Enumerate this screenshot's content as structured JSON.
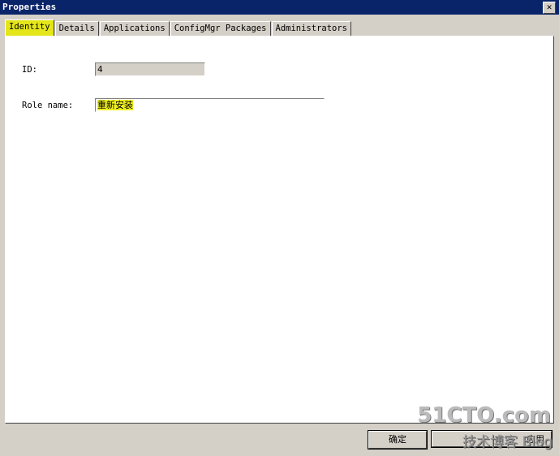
{
  "window": {
    "title": "Properties",
    "close": "✕"
  },
  "tabs": [
    {
      "label": "Identity"
    },
    {
      "label": "Details"
    },
    {
      "label": "Applications"
    },
    {
      "label": "ConfigMgr Packages"
    },
    {
      "label": "Administrators"
    }
  ],
  "form": {
    "id_label": "ID:",
    "id_value": "4",
    "role_label": "Role name:",
    "role_value": "重新安装"
  },
  "buttons": {
    "ok": "确定",
    "apply": "应用"
  },
  "watermark": {
    "line1": "51CTO.com",
    "line2": "技术博客 Blog"
  }
}
